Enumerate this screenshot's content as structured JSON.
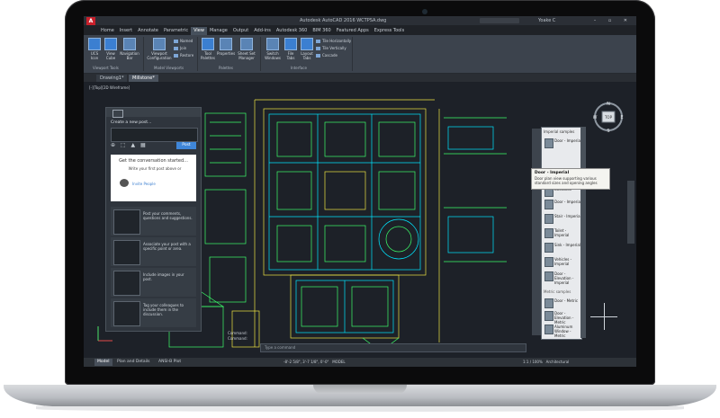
{
  "title_bar": {
    "app_logo": "A",
    "title": "Autodesk AutoCAD 2016   WCTPSA.dwg",
    "user": "Yoake C",
    "window_controls": "– ▫ ✕"
  },
  "ribbon_tabs": [
    "Home",
    "Insert",
    "Annotate",
    "Parametric",
    "View",
    "Manage",
    "Output",
    "Add-ins",
    "Autodesk 360",
    "BIM 360",
    "Featured Apps",
    "Express Tools"
  ],
  "ribbon_active_tab": "View",
  "ribbon": {
    "viewport_tools": {
      "buttons": [
        "UCS Icon",
        "View Cube",
        "Navigation Bar"
      ],
      "label": "Viewport Tools"
    },
    "model_viewports": {
      "configuration": "Viewport Configuration",
      "small": [
        "Named",
        "Join",
        "Restore"
      ],
      "label": "Model Viewports"
    },
    "palettes": {
      "buttons": [
        "Tool Palettes",
        "Properties",
        "Sheet Set Manager"
      ],
      "label": "Palettes"
    },
    "interface": {
      "buttons": [
        "Switch Windows",
        "File Tabs",
        "Layout Tabs"
      ],
      "small": [
        "Tile Horizontally",
        "Tile Vertically",
        "Cascade"
      ],
      "label": "Interface"
    }
  },
  "doc_tabs": [
    "Drawing1*",
    "Millstone*"
  ],
  "viewport_label": "[-][Top][2D Wireframe]",
  "post_panel": {
    "create_label": "Create a new post...",
    "tools": "⊕  ⬚  ▲  ▦",
    "post_button": "Post",
    "card_heading": "Get the conversation started...",
    "card_text": "Write your first post above or",
    "card_link": "Invite People",
    "tips": [
      "Post your comments, questions and suggestions.",
      "Associate your post with a specific point or area.",
      "Include images in your post.",
      "Tag your colleagues to include them in the discussion."
    ]
  },
  "tool_palette": {
    "title": "Imperial samples",
    "items": [
      "Door - Imperial",
      "Door - Elevation",
      "Bookcase",
      "Door - Imperial",
      "Door - Imperial",
      "Stair - Imperial",
      "Toilet - Imperial",
      "Sink - Imperial",
      "Vehicles - Imperial",
      "Door - Elevation - Imperial"
    ],
    "section": "Metric samples",
    "metric_items": [
      "Door - Metric",
      "Door - Elevation - Metric",
      "Aluminum Window - Metric"
    ],
    "side_tabs": "Modeling  Annotation  Architectural  Mechanical  Electrical  Civil  Structural  Hatches"
  },
  "tooltip": {
    "title": "Door - Imperial",
    "text": "Door plan view supporting various standard sizes and opening angles"
  },
  "view_cube": {
    "north": "N",
    "top": "TOP",
    "south": "S",
    "west": "W",
    "east": "E"
  },
  "command": {
    "history": [
      "Command:",
      "Command:",
      "Command:"
    ],
    "placeholder": "Type a command"
  },
  "layout_tabs": [
    "Model",
    "Plan and Details",
    "ANSI-B Plot"
  ],
  "status": {
    "coords": "-8'-2 5/8\", 3'-7 1/8\", 0'-0\"",
    "mode": "MODEL",
    "scale": "1:1 / 100%",
    "workspace": "Architectural"
  },
  "colors": {
    "lines_primary": "#00e5ff",
    "lines_secondary": "#f0e442",
    "lines_tertiary": "#3cff6a",
    "background": "#1d2128",
    "accent": "#3f86d8"
  }
}
